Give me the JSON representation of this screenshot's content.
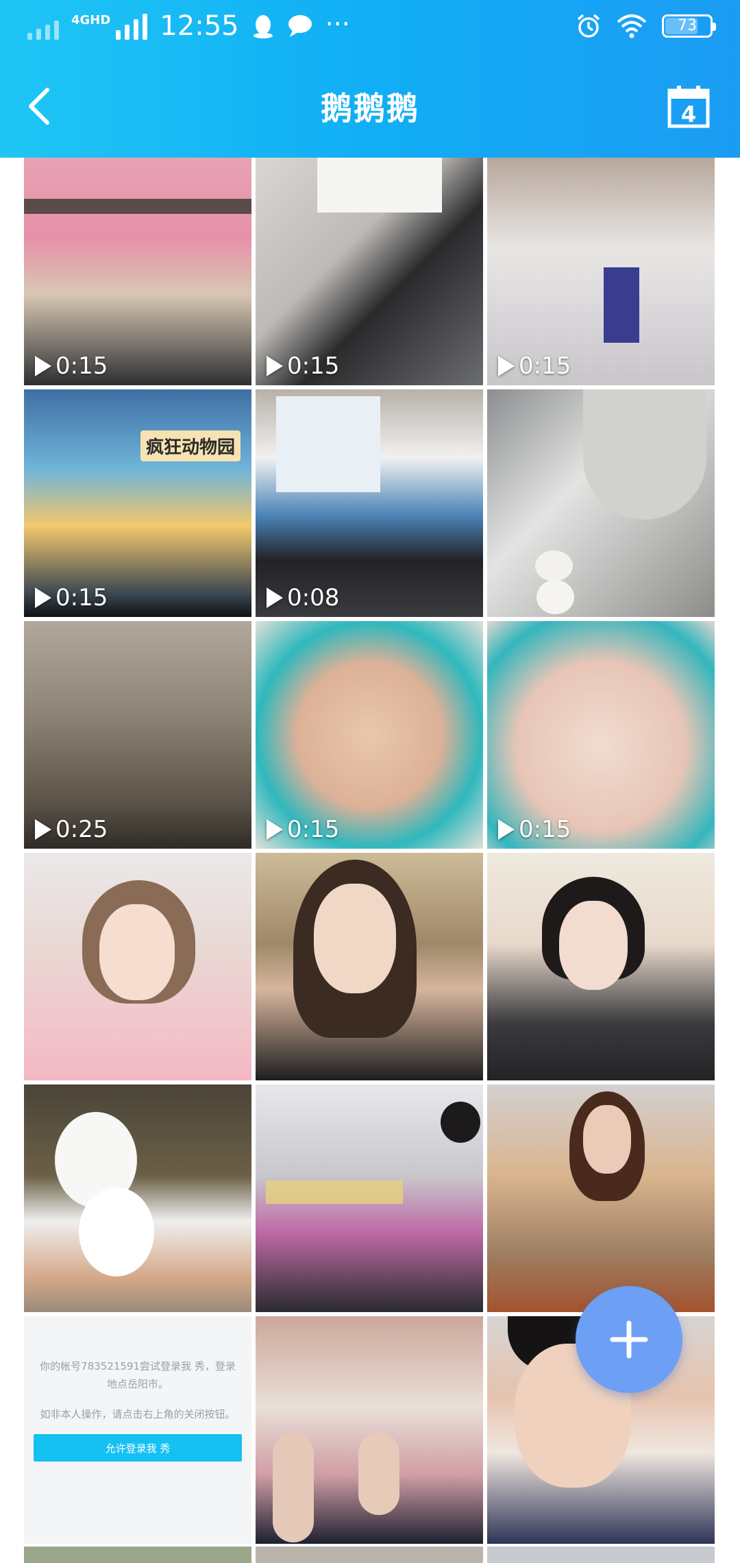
{
  "status_bar": {
    "network_tag": "4GHD",
    "time": "12:55",
    "battery": "73",
    "battery_level": 0.73,
    "icons": [
      "signal-icon",
      "qq-icon",
      "message-icon",
      "more-dots-icon",
      "alarm-icon",
      "wifi-icon",
      "battery-icon"
    ],
    "more_dots": "···"
  },
  "navbar": {
    "title": "鹅鹅鹅",
    "back_icon": "back-chevron-icon",
    "calendar_icon": "calendar-icon",
    "calendar_day": "4"
  },
  "grid": {
    "tiles": [
      {
        "duration": "0:15",
        "type": "video"
      },
      {
        "duration": "0:15",
        "type": "video"
      },
      {
        "duration": "0:15",
        "type": "video"
      },
      {
        "duration": "0:15",
        "type": "video"
      },
      {
        "duration": "0:08",
        "type": "video"
      },
      {
        "duration": "",
        "type": "photo"
      },
      {
        "duration": "0:25",
        "type": "video"
      },
      {
        "duration": "0:15",
        "type": "video"
      },
      {
        "duration": "0:15",
        "type": "video"
      },
      {
        "duration": "",
        "type": "photo"
      },
      {
        "duration": "",
        "type": "photo"
      },
      {
        "duration": "",
        "type": "photo"
      },
      {
        "duration": "",
        "type": "photo"
      },
      {
        "duration": "",
        "type": "photo"
      },
      {
        "duration": "",
        "type": "photo"
      },
      {
        "duration": "",
        "type": "screenshot"
      },
      {
        "duration": "",
        "type": "photo"
      },
      {
        "duration": "",
        "type": "photo"
      }
    ],
    "tile4_sign": "疯狂动物园",
    "screenshot_note_line1": "你的帐号783521591尝试登录我 秀，登录地点岳阳市。",
    "screenshot_note_line2": "如非本人操作，请点击右上角的关闭按钮。",
    "screenshot_button": "允许登录我 秀"
  },
  "fab": {
    "icon": "plus-icon",
    "color": "#6d9ff5"
  },
  "colors": {
    "header_start": "#1fc6f5",
    "header_end": "#1b9cf3",
    "accent": "#15c0f2"
  }
}
